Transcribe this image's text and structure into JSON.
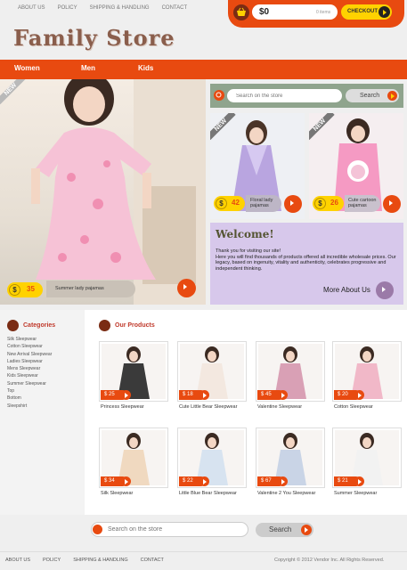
{
  "top_nav": [
    "ABOUT US",
    "POLICY",
    "SHIPPING & HANDLING",
    "CONTACT"
  ],
  "cart": {
    "total": "$0",
    "items": "0 items",
    "checkout_label": "CHECKOUT"
  },
  "logo": "Family Store",
  "main_nav": [
    "Women",
    "Men",
    "Kids"
  ],
  "hero": {
    "tag": "NEW",
    "price": "35",
    "label": "Summer lady pajamas"
  },
  "search": {
    "placeholder": "Search on the store",
    "button": "Search"
  },
  "featured": [
    {
      "tag": "NEW",
      "price": "42",
      "label": "Floral lady pajamas"
    },
    {
      "tag": "NEW",
      "price": "26",
      "label": "Cute cartoon pajamas"
    }
  ],
  "welcome": {
    "title": "Welcome!",
    "text": "Thank you for visiting our site!\nHere you will find thousands of products offered all incredible wholesale prices. Our legacy, based on ingenuity, vitality and authenticity, celebrates progressive and independent thinking.",
    "more": "More About Us"
  },
  "categories": {
    "title": "Categories",
    "items": [
      "Silk Sleepwear",
      "Cotton Sleepwear",
      "New Arrival Sleepwear",
      "Ladies Sleepwear",
      "Mens Sleepwear",
      "Kids Sleepwear",
      "Summer Sleepwear",
      "Top",
      "Bottom",
      "Sleepshirt"
    ]
  },
  "products": {
    "title": "Our Products",
    "items": [
      {
        "price": "$ 25",
        "name": "Princess Sleepwear",
        "color": "#3a3a3a"
      },
      {
        "price": "$ 18",
        "name": "Cute Little Bear Sleepwear",
        "color": "#f3e8e0"
      },
      {
        "price": "$ 45",
        "name": "Valentine Sleepwear",
        "color": "#d9a0b5"
      },
      {
        "price": "$ 20",
        "name": "Cotton Sleepwear",
        "color": "#f1b8c8"
      },
      {
        "price": "$ 34",
        "name": "Silk Sleepwear",
        "color": "#f0d9c0"
      },
      {
        "price": "$ 22",
        "name": "Little Blue Bear Sleepwear",
        "color": "#d7e3f0"
      },
      {
        "price": "$ 67",
        "name": "Valentine 2 You Sleepwear",
        "color": "#c9d4e6"
      },
      {
        "price": "$ 21",
        "name": "Summer Sleepwear",
        "color": "#f2f2f2"
      }
    ]
  },
  "bottom_search": {
    "placeholder": "Search on the store",
    "button": "Search"
  },
  "footer": {
    "nav": [
      "ABOUT US",
      "POLICY",
      "SHIPPING & HANDLING",
      "CONTACT"
    ],
    "copyright": "Copyright © 2012 Vendor Inc. All Rights Reserved."
  },
  "colors": {
    "accent": "#e84a10",
    "yellow": "#ffd200",
    "lavender": "#d7c8eb",
    "sage": "#8fa48d"
  }
}
